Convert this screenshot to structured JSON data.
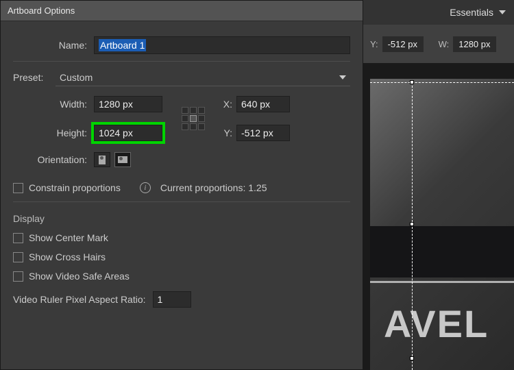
{
  "topbar": {
    "workspace": "Essentials"
  },
  "properties": {
    "y_label": "Y:",
    "y_value": "-512 px",
    "w_label": "W:",
    "w_value": "1280 px"
  },
  "dialog": {
    "title": "Artboard Options",
    "name_label": "Name:",
    "name_value": "Artboard 1",
    "preset_label": "Preset:",
    "preset_value": "Custom",
    "width_label": "Width:",
    "width_value": "1280 px",
    "height_label": "Height:",
    "height_value": "1024 px",
    "x_label": "X:",
    "x_value": "640 px",
    "y_label": "Y:",
    "y_value": "-512 px",
    "orientation_label": "Orientation:",
    "constrain_label": "Constrain proportions",
    "proportions_label": "Current proportions: 1.25",
    "display_heading": "Display",
    "show_center": "Show Center Mark",
    "show_cross": "Show Cross Hairs",
    "show_safe": "Show Video Safe Areas",
    "ruler_label": "Video Ruler Pixel Aspect Ratio:",
    "ruler_value": "1"
  },
  "bg": {
    "text": "AVEL"
  },
  "colors": {
    "highlight": "#00d400",
    "selection": "#1b5db4"
  }
}
